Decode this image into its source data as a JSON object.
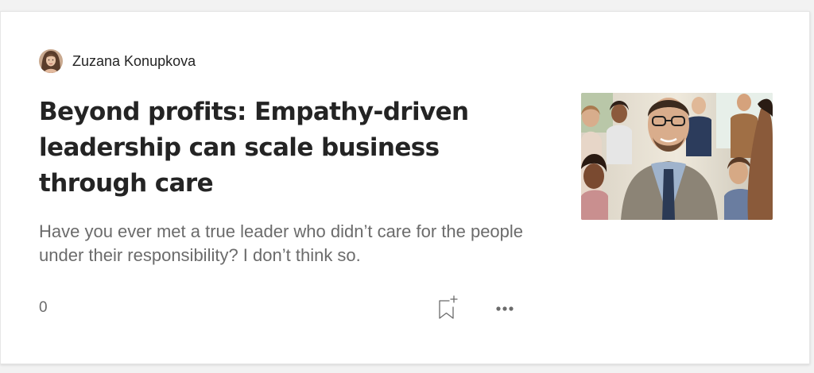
{
  "author": {
    "name": "Zuzana Konupkova"
  },
  "article": {
    "title": "Beyond profits: Empathy-driven leadership can scale business through care",
    "subtitle": "Have you ever met a true leader who didn’t care for the people under their responsibility? I don’t think so.",
    "claps": "0"
  },
  "icons": {
    "bookmark": "bookmark-add-icon",
    "more": "more-horizontal-icon"
  },
  "colors": {
    "title": "#242424",
    "subtitle": "#6b6b6b",
    "icon": "#6b6b6b"
  }
}
